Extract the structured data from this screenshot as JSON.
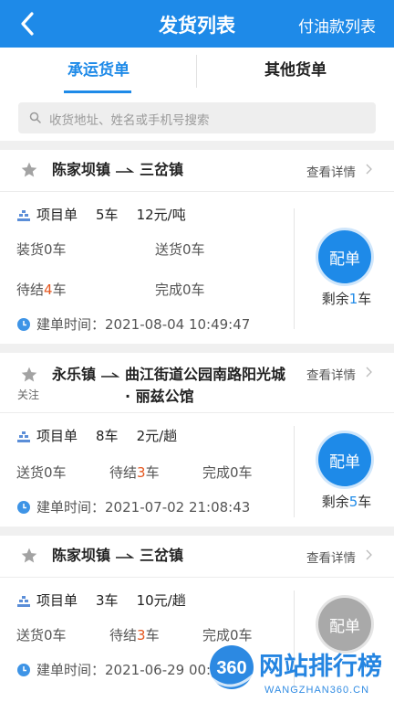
{
  "header": {
    "title": "发货列表",
    "right_link": "付油款列表"
  },
  "tabs": [
    {
      "label": "承运货单",
      "active": true
    },
    {
      "label": "其他货单",
      "active": false
    }
  ],
  "search": {
    "placeholder": "收货地址、姓名或手机号搜索"
  },
  "colors": {
    "accent": "#1e8ae8",
    "highlight": "#e5571f",
    "disabled": "#a9a9a9"
  },
  "orders": [
    {
      "origin": "陈家坝镇",
      "destination": "三岔镇",
      "detail_label": "查看详情",
      "type": "项目单",
      "trucks": "5车",
      "price": "12元/吨",
      "loading": "装货0车",
      "delivering": "送货0车",
      "pending_prefix": "待结",
      "pending_num": "4",
      "pending_suffix": "车",
      "completed": "完成0车",
      "created_label": "建单时间：",
      "created_time": "2021-08-04 10:49:47",
      "dispatch_label": "配单",
      "remain_prefix": "剩余",
      "remain_num": "1",
      "remain_suffix": "车"
    },
    {
      "follow_label": "关注",
      "origin": "永乐镇",
      "destination_line1": "曲江街道公园南路阳光城",
      "destination_line2": "· 丽兹公馆",
      "detail_label": "查看详情",
      "type": "项目单",
      "trucks": "8车",
      "price": "2元/趟",
      "delivering": "送货0车",
      "pending_prefix": "待结",
      "pending_num": "3",
      "pending_suffix": "车",
      "completed": "完成0车",
      "created_label": "建单时间：",
      "created_time": "2021-07-02 21:08:43",
      "dispatch_label": "配单",
      "remain_prefix": "剩余",
      "remain_num": "5",
      "remain_suffix": "车"
    },
    {
      "origin": "陈家坝镇",
      "destination": "三岔镇",
      "detail_label": "查看详情",
      "type": "项目单",
      "trucks": "3车",
      "price": "10元/趟",
      "delivering": "送货0车",
      "pending_prefix": "待结",
      "pending_num": "3",
      "pending_suffix": "车",
      "completed": "完成0车",
      "created_label": "建单时间：",
      "created_time": "2021-06-29 00:",
      "dispatch_label": "配单"
    }
  ],
  "watermark": {
    "badge": "360",
    "name": "网站排行榜",
    "url": "WANGZHAN360.CN"
  }
}
